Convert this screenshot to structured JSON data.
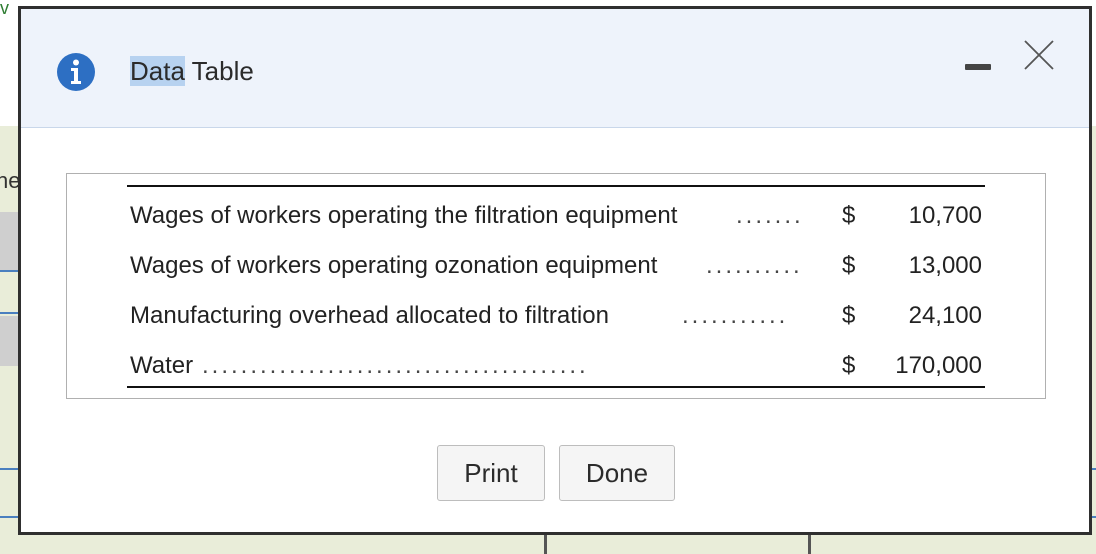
{
  "background": {
    "fragment_top": "v",
    "fragment_left": "he"
  },
  "dialog": {
    "title_highlighted": "Data",
    "title_rest": " Table",
    "icons": {
      "info": "info-icon",
      "minimize": "minimize-icon",
      "close": "close-icon"
    },
    "colors": {
      "header_bg": "#eef3fb",
      "info_icon": "#2d6fc3",
      "selection": "#b7d2f0"
    }
  },
  "table": {
    "rows": [
      {
        "label": "Wages of workers operating the filtration equipment",
        "dots": ".......",
        "currency": "$",
        "amount": "10,700"
      },
      {
        "label": "Wages of workers operating ozonation equipment",
        "dots": "..........",
        "currency": "$",
        "amount": "13,000"
      },
      {
        "label": "Manufacturing overhead allocated to filtration",
        "dots": "...........",
        "currency": "$",
        "amount": "24,100"
      },
      {
        "label": "Water",
        "dots": "........................................",
        "currency": "$",
        "amount": "170,000"
      }
    ]
  },
  "buttons": {
    "print": "Print",
    "done": "Done"
  }
}
